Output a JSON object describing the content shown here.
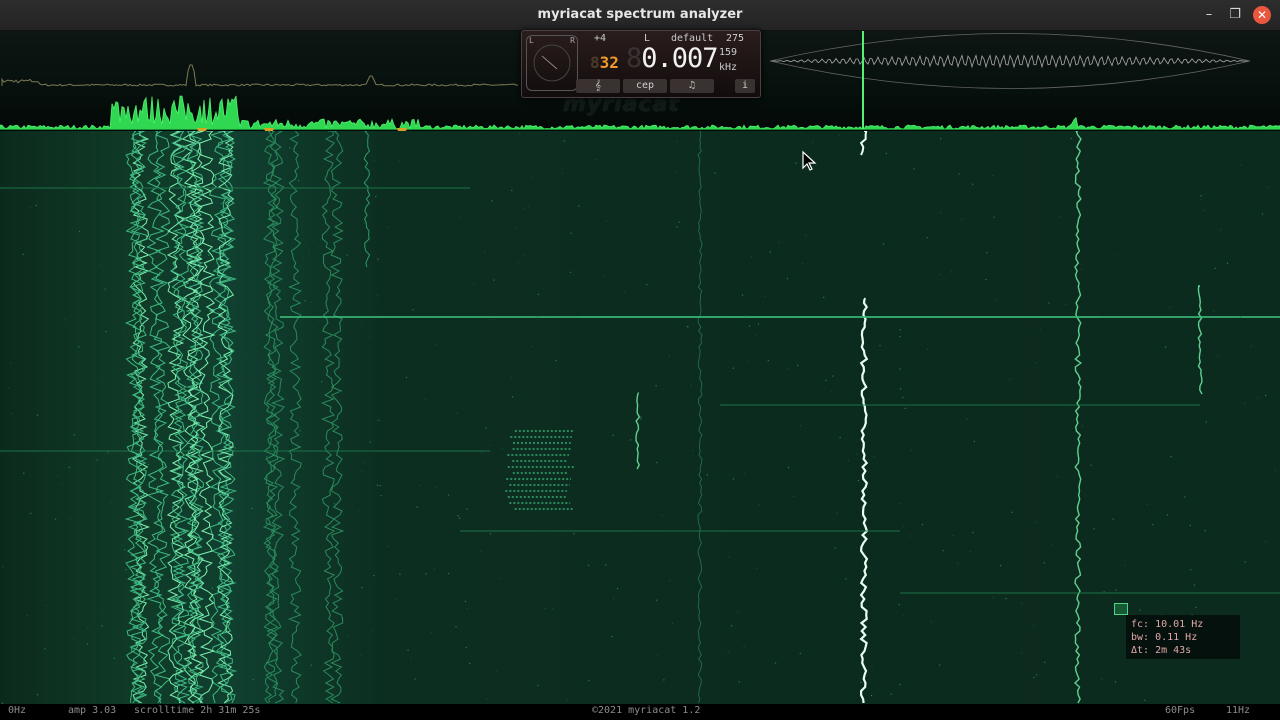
{
  "window": {
    "title": "myriacat spectrum analyzer",
    "minimize": "–",
    "maximize": "❐",
    "close": "✕"
  },
  "readout": {
    "scope_left": "L",
    "scope_right": "R",
    "shift": "+4",
    "channel": "L",
    "preset": "default",
    "value_275": "275",
    "bins": "32",
    "bins_ghost": "8",
    "frequency_ghost": "8",
    "frequency": "0.007",
    "value_159": "159",
    "unit": "kHz",
    "buttons": [
      "𝄞",
      "cep",
      "♫",
      "i"
    ]
  },
  "brand_watermark": "myriacat",
  "selection_info": {
    "fc": "fc: 10.01 Hz",
    "bw": "bw: 0.11 Hz",
    "dt": "Δt: 2m 43s"
  },
  "status": {
    "left_freq": "0Hz",
    "amp": "amp 3.03",
    "scrolltime": "scrolltime 2h 31m 25s",
    "copyright": "©2021 myriacat 1.2",
    "fps": "60Fps",
    "right_freq": "11Hz"
  },
  "colors": {
    "accent_green": "#3ee06a",
    "marker_orange": "#d8a028",
    "close_red": "#e9573f"
  }
}
